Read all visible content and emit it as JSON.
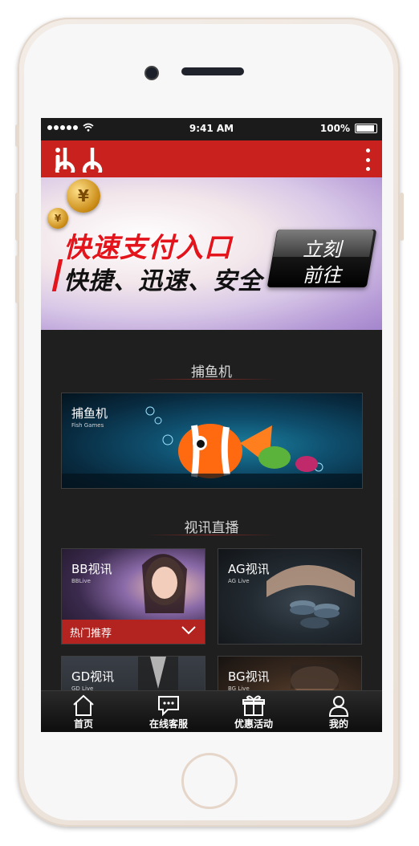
{
  "status_bar": {
    "time": "9:41 AM",
    "battery": "100%"
  },
  "app_bar": {
    "logo_text": "ibb"
  },
  "banner": {
    "headline": "快速支付入口",
    "subline": "快捷、迅速、安全",
    "cta_line1": "立刻",
    "cta_line2": "前往",
    "coin_glyph": "¥"
  },
  "sections": {
    "fish": {
      "title": "捕鱼机",
      "card_title": "捕鱼机",
      "card_sub": "Fish Games"
    },
    "live": {
      "title": "视讯直播",
      "cards": [
        {
          "title": "BB视讯",
          "sub": "BBLive"
        },
        {
          "title": "AG视讯",
          "sub": "AG Live"
        },
        {
          "title": "GD视讯",
          "sub": "GD Live"
        },
        {
          "title": "BG视讯",
          "sub": "BG Live"
        }
      ],
      "hot_label": "热门推荐"
    }
  },
  "tabbar": [
    {
      "label": "首页",
      "icon": "home-icon"
    },
    {
      "label": "在线客服",
      "icon": "chat-icon"
    },
    {
      "label": "优惠活动",
      "icon": "gift-icon"
    },
    {
      "label": "我的",
      "icon": "user-icon"
    }
  ],
  "colors": {
    "brand_red": "#c9211e",
    "background": "#1f1f1f"
  }
}
